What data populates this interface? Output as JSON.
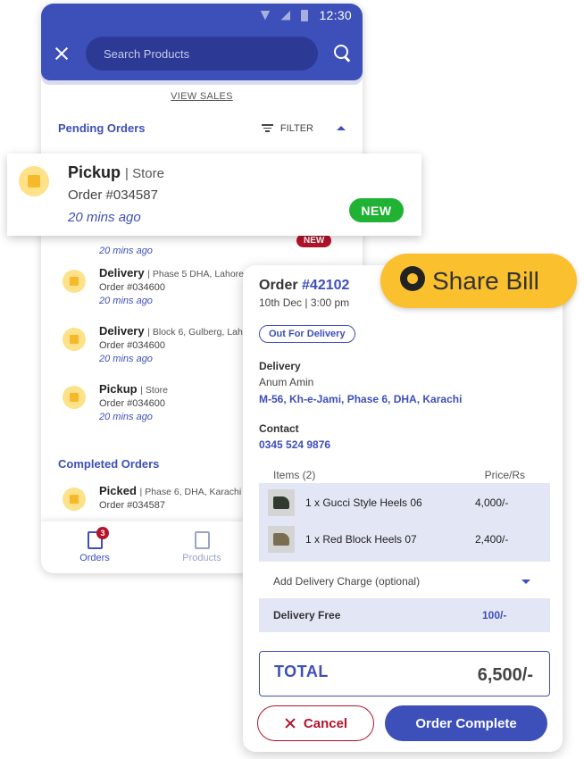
{
  "status_bar": {
    "time": "12:30"
  },
  "search": {
    "placeholder": "Search Products"
  },
  "links": {
    "view_sales": "VIEW SALES"
  },
  "pending": {
    "title": "Pending Orders",
    "filter_label": "FILTER"
  },
  "completed": {
    "title": "Completed Orders"
  },
  "pickup_card": {
    "type": "Pickup",
    "location": "| Store",
    "order_number": "Order #034587",
    "time": "20 mins ago",
    "badge": "NEW"
  },
  "hidden_row": {
    "time": "20 mins ago",
    "badge": "NEW"
  },
  "order_list": [
    {
      "type": "Delivery",
      "location": "| Phase 5 DHA, Lahore",
      "order_number": "Order #034600",
      "time": "20 mins ago"
    },
    {
      "type": "Delivery",
      "location": "| Block 6, Gulberg, Lah",
      "order_number": "Order #034600",
      "time": "20 mins ago"
    },
    {
      "type": "Pickup",
      "location": "| Store",
      "order_number": "Order #034600",
      "time": "20 mins ago"
    }
  ],
  "completed_list": [
    {
      "type": "Picked",
      "location": "| Phase 6, DHA, Karachi",
      "order_number": "Order #034587"
    }
  ],
  "bottom_nav": {
    "orders_label": "Orders",
    "orders_badge": "3",
    "products_label": "Products"
  },
  "share_bill": {
    "label": "Share Bill"
  },
  "order_detail": {
    "title_prefix": "Order",
    "order_number": "#42102",
    "date": "10th Dec | 3:00 pm",
    "status": "Out For Delivery",
    "delivery_label": "Delivery",
    "customer_name": "Anum Amin",
    "address": "M-56, Kh-e-Jami, Phase 6, DHA, Karachi",
    "contact_label": "Contact",
    "phone": "0345 524 9876",
    "items_header": "Items (2)",
    "price_header": "Price/Rs",
    "items": [
      {
        "name": "1 x Gucci Style Heels 06",
        "price": "4,000/-"
      },
      {
        "name": "1 x Red Block Heels 07",
        "price": "2,400/-"
      }
    ],
    "delivery_charge_label": "Add Delivery Charge (optional)",
    "delivery_free_label": "Delivery Free",
    "delivery_free_value": "100/-",
    "total_label": "TOTAL",
    "total_value": "6,500/-",
    "cancel_label": "Cancel",
    "complete_label": "Order Complete"
  },
  "colors": {
    "primary": "#3d4fb8",
    "accent_yellow": "#fbc02d",
    "danger": "#b3132b",
    "success": "#1fb233"
  }
}
